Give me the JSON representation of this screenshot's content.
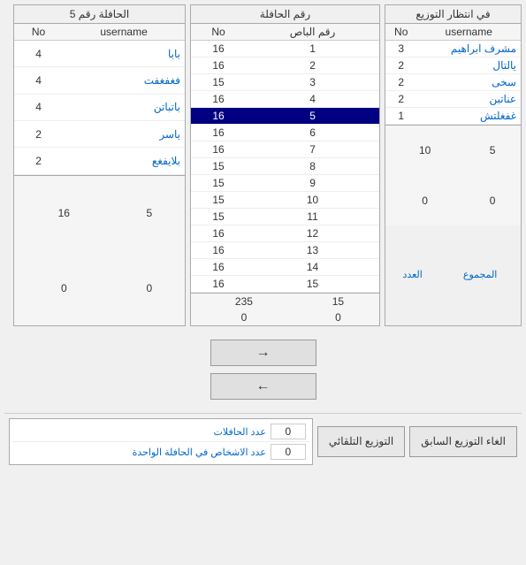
{
  "panels": {
    "left": {
      "title": "في انتظار التوزيع",
      "col1": "username",
      "col2": "No",
      "rows": [
        {
          "name": "مشرف ابراهيم",
          "no": "3"
        },
        {
          "name": "يالتال",
          "no": "2"
        },
        {
          "name": "سخى",
          "no": "2"
        },
        {
          "name": "عناتبن",
          "no": "2"
        },
        {
          "name": "غفغلتش",
          "no": "1"
        }
      ],
      "footer1_c1": "5",
      "footer1_c2": "10",
      "footer2_c1": "0",
      "footer2_c2": "0",
      "label1": "المجموع",
      "label2": "العدد"
    },
    "middle": {
      "title": "رقم الحافلة",
      "col1": "رقم الباص",
      "col2": "No",
      "rows": [
        {
          "num": "1",
          "no": "16",
          "selected": false
        },
        {
          "num": "2",
          "no": "16",
          "selected": false
        },
        {
          "num": "3",
          "no": "15",
          "selected": false
        },
        {
          "num": "4",
          "no": "16",
          "selected": false
        },
        {
          "num": "5",
          "no": "16",
          "selected": true
        },
        {
          "num": "6",
          "no": "16",
          "selected": false
        },
        {
          "num": "7",
          "no": "16",
          "selected": false
        },
        {
          "num": "8",
          "no": "15",
          "selected": false
        },
        {
          "num": "9",
          "no": "15",
          "selected": false
        },
        {
          "num": "10",
          "no": "15",
          "selected": false
        },
        {
          "num": "11",
          "no": "15",
          "selected": false
        },
        {
          "num": "12",
          "no": "16",
          "selected": false
        },
        {
          "num": "13",
          "no": "16",
          "selected": false
        },
        {
          "num": "14",
          "no": "16",
          "selected": false
        },
        {
          "num": "15",
          "no": "16",
          "selected": false
        }
      ],
      "footer1_c1": "15",
      "footer1_c2": "235",
      "footer2_c1": "0",
      "footer2_c2": "0"
    },
    "right": {
      "title": "الحافلة رقم 5",
      "col1": "username",
      "col2": "No",
      "rows": [
        {
          "name": "بابا",
          "no": "4"
        },
        {
          "name": "فغفغفت",
          "no": "4"
        },
        {
          "name": "باتباتن",
          "no": "4"
        },
        {
          "name": "ياسر",
          "no": "2"
        },
        {
          "name": "بلايفغع",
          "no": "2"
        }
      ],
      "footer1_c1": "5",
      "footer1_c2": "16",
      "footer2_c1": "0",
      "footer2_c2": "0"
    }
  },
  "buttons": {
    "forward_arrow": "→",
    "back_arrow": "←",
    "auto_distribute": "التوزيع التلقائي",
    "cancel_prev": "الغاء التوزيع السابق"
  },
  "info": {
    "bus_count_label": "عدد الحافلات",
    "persons_per_bus_label": "عدد الاشخاص في الحافلة الواحدة",
    "bus_count_value": "0",
    "persons_per_bus_value": "0"
  }
}
